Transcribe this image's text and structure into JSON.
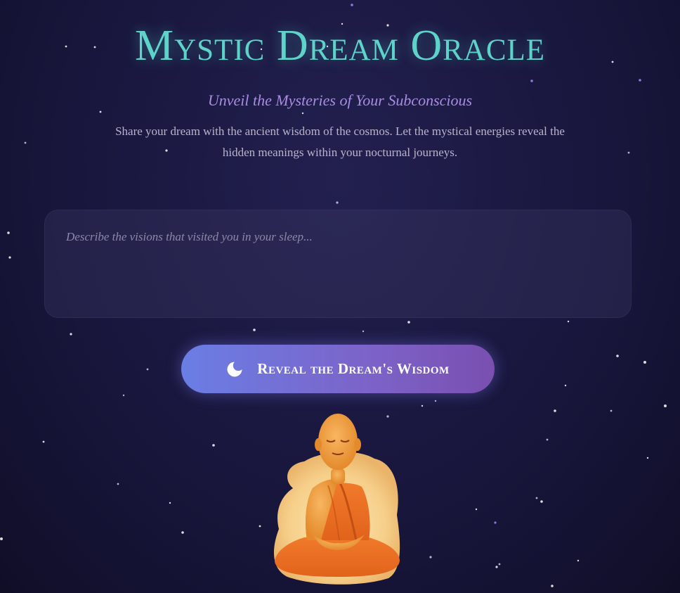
{
  "header": {
    "title": "Mystic Dream Oracle",
    "subtitle": "Unveil the Mysteries of Your Subconscious",
    "description": "Share your dream with the ancient wisdom of the cosmos. Let the mystical energies reveal the hidden meanings within your nocturnal journeys."
  },
  "dream_input": {
    "value": "",
    "placeholder": "Describe the visions that visited you in your sleep..."
  },
  "reveal_button": {
    "label": "Reveal the Dream's Wisdom",
    "icon": "crescent-moon-icon"
  },
  "illustration": {
    "subject": "meditating-monk-icon"
  },
  "colors": {
    "title": "#5ed3c9",
    "subtitle": "#a98de0",
    "button_start": "#6a7ee4",
    "button_end": "#7a4fb0",
    "background": "#1a1840"
  }
}
